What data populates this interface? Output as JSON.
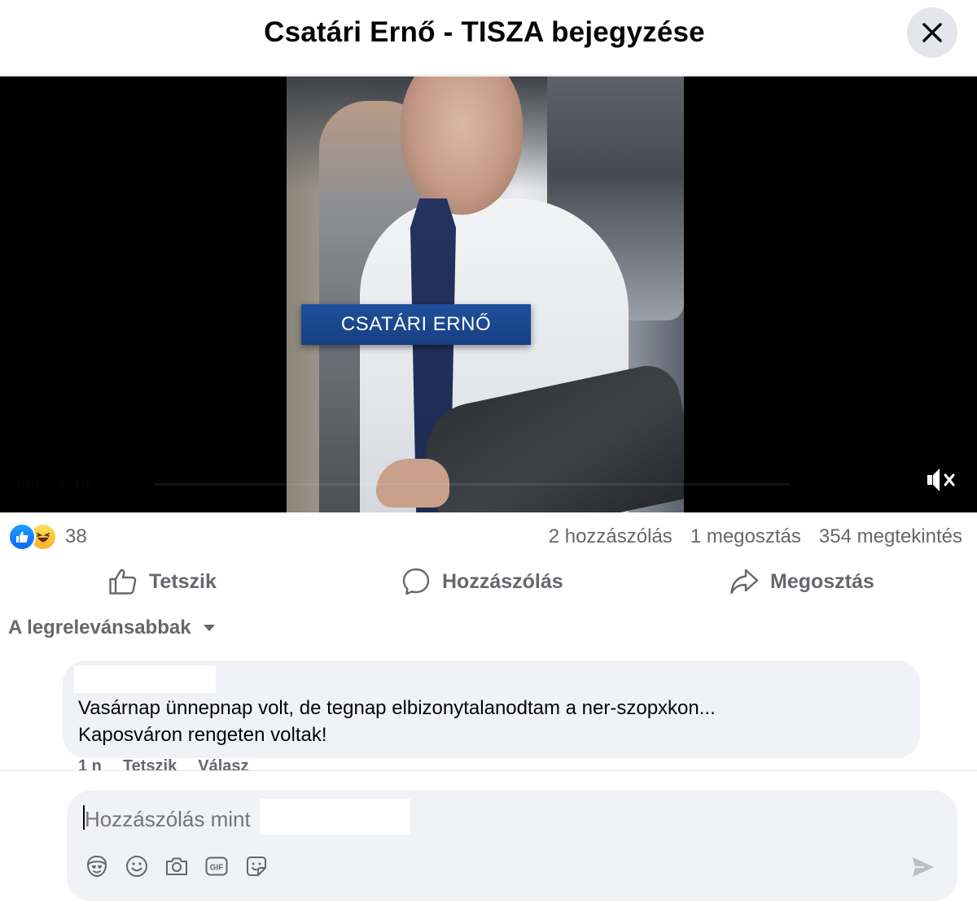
{
  "header": {
    "title": "Csatári Ernő - TISZA bejegyzése",
    "close_icon": "close-icon"
  },
  "video": {
    "lower_third": "CSATÁRI ERNŐ",
    "faint_control_text": "0:05 / 1:18",
    "muted": true,
    "mute_icon": "volume-muted-icon"
  },
  "stats": {
    "reactions": [
      "like",
      "haha"
    ],
    "reaction_count": "38",
    "comments": "2 hozzászólás",
    "shares": "1 megosztás",
    "views": "354 megtekintés"
  },
  "actions": {
    "like_label": "Tetszik",
    "comment_label": "Hozzászólás",
    "share_label": "Megosztás"
  },
  "sort": {
    "label": "A legrelevánsabbak"
  },
  "comments": [
    {
      "author": "",
      "line1": "Vasárnap ünnepnap volt, de tegnap elbizonytalanodtam a ner-szopxkon...",
      "line2": "Kaposváron rengeten voltak!",
      "time": "1 n",
      "like": "Tetszik",
      "reply": "Válasz"
    }
  ],
  "composer": {
    "placeholder": "Hozzászólás mint",
    "tools": [
      "avatar-sticker-icon",
      "emoji-icon",
      "camera-icon",
      "gif-icon",
      "sticker-icon"
    ],
    "send_icon": "send-icon"
  },
  "colors": {
    "text_primary": "#050505",
    "text_secondary": "#65676b",
    "bubble_bg": "#f0f2f5",
    "like_blue": "#0866ff",
    "haha_yellow": "#f7b125",
    "lower_third_blue": "#1f4f9c"
  }
}
